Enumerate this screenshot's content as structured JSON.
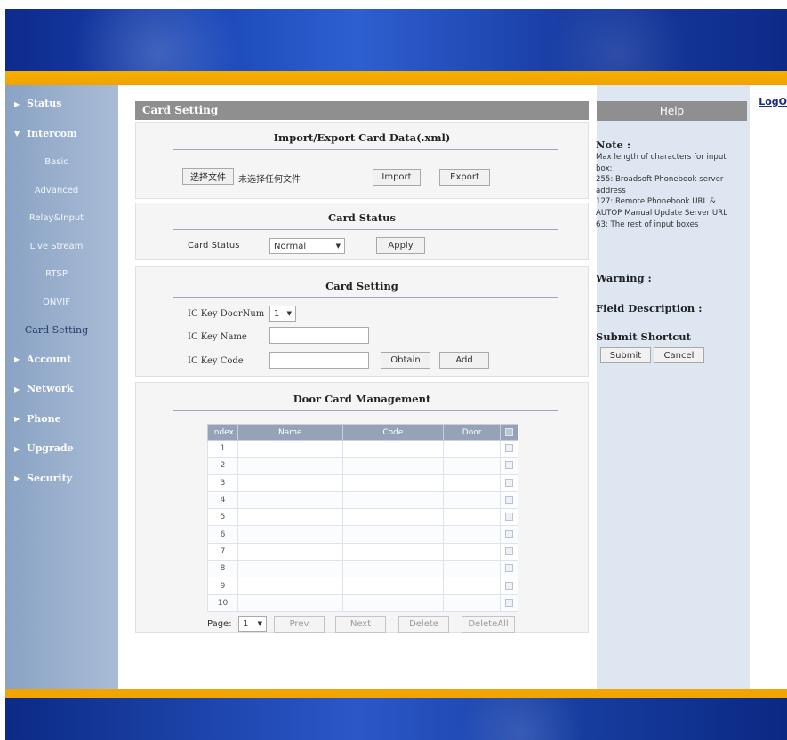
{
  "header": {
    "logout_label": "LogO"
  },
  "sidebar": {
    "items": [
      {
        "label": "Status",
        "expanded": false
      },
      {
        "label": "Intercom",
        "expanded": true
      },
      {
        "label": "Account",
        "expanded": false
      },
      {
        "label": "Network",
        "expanded": false
      },
      {
        "label": "Phone",
        "expanded": false
      },
      {
        "label": "Upgrade",
        "expanded": false
      },
      {
        "label": "Security",
        "expanded": false
      }
    ],
    "intercom_subitems": [
      "Basic",
      "Advanced",
      "Relay&Input",
      "Live Stream",
      "RTSP",
      "ONVIF",
      "Card Setting"
    ],
    "active_subitem": "Card Setting"
  },
  "page": {
    "title": "Card Setting"
  },
  "import_export": {
    "title": "Import/Export Card Data(.xml)",
    "choose_file_label": "选择文件",
    "no_file_text": "未选择任何文件",
    "import_label": "Import",
    "export_label": "Export"
  },
  "card_status": {
    "title": "Card Status",
    "field_label": "Card Status",
    "selected_value": "Normal",
    "apply_label": "Apply"
  },
  "card_setting": {
    "title": "Card Setting",
    "doornum_label": "IC Key DoorNum",
    "doornum_value": "1",
    "name_label": "IC Key Name",
    "name_value": "",
    "code_label": "IC Key Code",
    "code_value": "",
    "obtain_label": "Obtain",
    "add_label": "Add"
  },
  "door_card_management": {
    "title": "Door Card Management",
    "columns": [
      "Index",
      "Name",
      "Code",
      "Door"
    ],
    "rows": [
      {
        "index": "1",
        "name": "",
        "code": "",
        "door": ""
      },
      {
        "index": "2",
        "name": "",
        "code": "",
        "door": ""
      },
      {
        "index": "3",
        "name": "",
        "code": "",
        "door": ""
      },
      {
        "index": "4",
        "name": "",
        "code": "",
        "door": ""
      },
      {
        "index": "5",
        "name": "",
        "code": "",
        "door": ""
      },
      {
        "index": "6",
        "name": "",
        "code": "",
        "door": ""
      },
      {
        "index": "7",
        "name": "",
        "code": "",
        "door": ""
      },
      {
        "index": "8",
        "name": "",
        "code": "",
        "door": ""
      },
      {
        "index": "9",
        "name": "",
        "code": "",
        "door": ""
      },
      {
        "index": "10",
        "name": "",
        "code": "",
        "door": ""
      }
    ],
    "page_label": "Page:",
    "page_value": "1",
    "prev_label": "Prev",
    "next_label": "Next",
    "delete_label": "Delete",
    "delete_all_label": "DeleteAll"
  },
  "help": {
    "title": "Help",
    "note_heading": "Note :",
    "note_lines": [
      "Max length of characters for input",
      "box:",
      "255: Broadsoft Phonebook server",
      "address",
      "127: Remote Phonebook URL &",
      "AUTOP Manual Update Server URL",
      "63: The rest of input boxes"
    ],
    "warning_heading": "Warning :",
    "field_desc_heading": "Field Description :",
    "shortcut_heading": "Submit Shortcut",
    "submit_label": "Submit",
    "cancel_label": "Cancel"
  },
  "colors": {
    "banner_blue": "#1a47b8",
    "accent_orange": "#f2a200",
    "sidebar_bg": "#9bb0cc",
    "title_bar_gray": "#8f8f8f",
    "help_bg": "#dde6f1"
  }
}
